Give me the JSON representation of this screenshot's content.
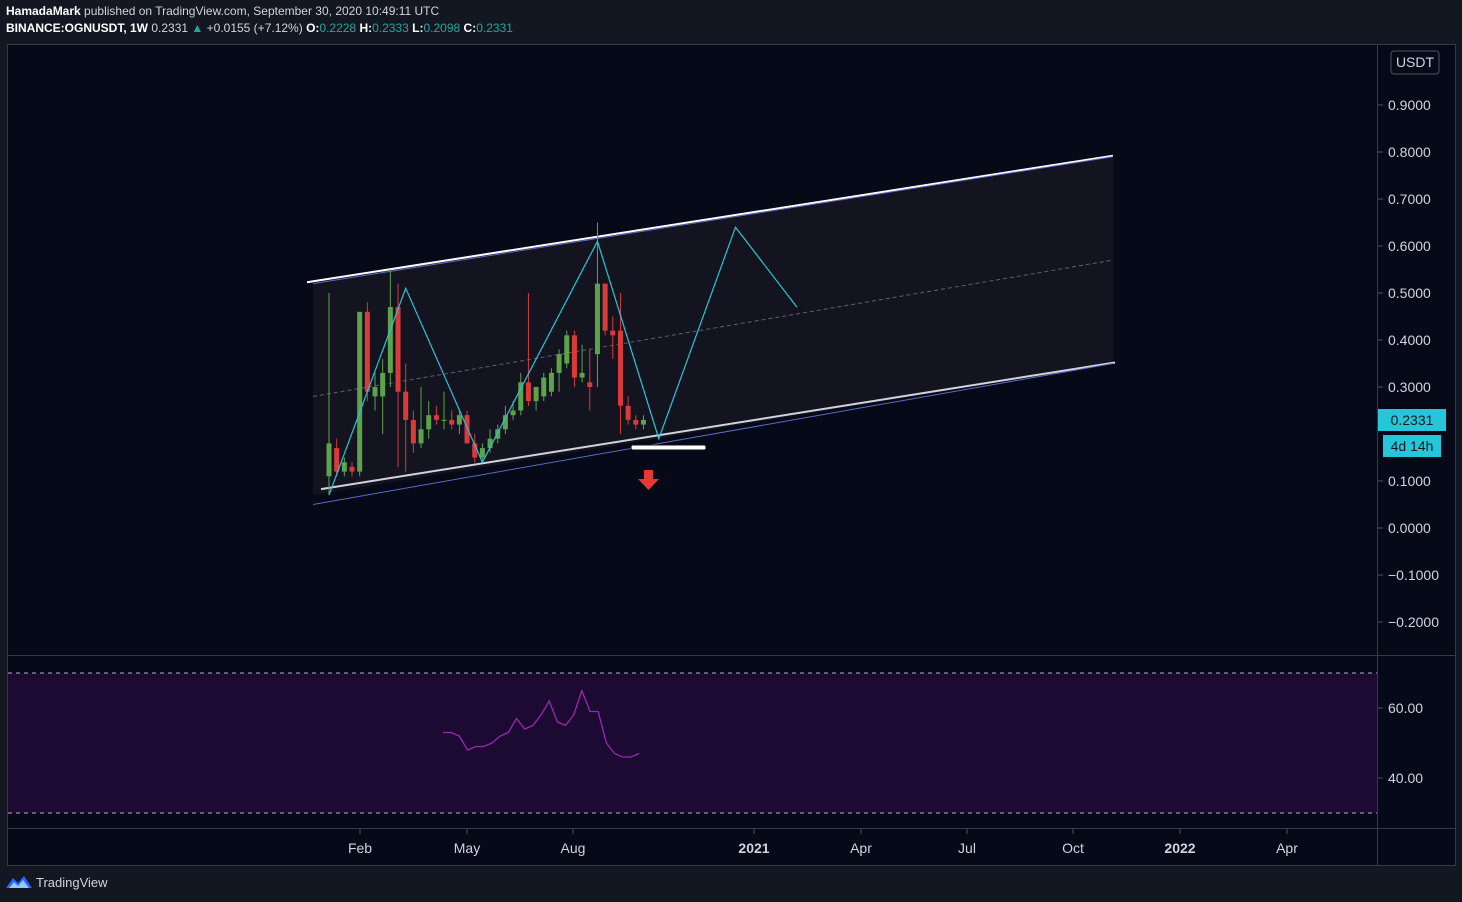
{
  "header": {
    "author": "HamadaMark",
    "published_text": "published on TradingView.com, September 30, 2020 10:49:11 UTC",
    "symbol": "BINANCE:OGNUSDT, 1W",
    "last": "0.2331",
    "change": "+0.0155 (+7.12%)",
    "open_label": "O:",
    "open": "0.2228",
    "high_label": "H:",
    "high": "0.2333",
    "low_label": "L:",
    "low": "0.2098",
    "close_label": "C:",
    "close": "0.2331"
  },
  "footer": {
    "brand": "TradingView"
  },
  "colors": {
    "background": "#131722",
    "pane": "#050918",
    "up": "#5ca34a",
    "down": "#d93a3a",
    "wave": "#26c6da",
    "rsi_line": "#9c27b0",
    "rsi_band": "#1c0a33",
    "price_badge": "#26c6da",
    "arrow": "#e53935"
  },
  "chart_data": [
    {
      "type": "candlestick",
      "currency_label": "USDT",
      "ylim": [
        -0.25,
        0.95
      ],
      "y_ticks": [
        "0.9000",
        "0.8000",
        "0.7000",
        "0.6000",
        "0.5000",
        "0.4000",
        "0.3000",
        "0.1000",
        "0.0000",
        "−0.1000",
        "−0.2000"
      ],
      "last_price_badge": "0.2331",
      "countdown_badge": "4d 14h",
      "x_ticks": [
        "Feb",
        "May",
        "Aug",
        "2021",
        "Apr",
        "Jul",
        "Oct",
        "2022",
        "Apr"
      ],
      "x_tick_bold": [
        false,
        false,
        false,
        true,
        false,
        false,
        false,
        true,
        false
      ],
      "candles": [
        {
          "o": 0.11,
          "h": 0.5,
          "l": 0.07,
          "c": 0.18
        },
        {
          "o": 0.17,
          "h": 0.19,
          "l": 0.11,
          "c": 0.12
        },
        {
          "o": 0.12,
          "h": 0.15,
          "l": 0.11,
          "c": 0.14
        },
        {
          "o": 0.13,
          "h": 0.14,
          "l": 0.11,
          "c": 0.12
        },
        {
          "o": 0.12,
          "h": 0.4,
          "l": 0.11,
          "c": 0.46
        },
        {
          "o": 0.46,
          "h": 0.48,
          "l": 0.27,
          "c": 0.29
        },
        {
          "o": 0.28,
          "h": 0.33,
          "l": 0.25,
          "c": 0.3
        },
        {
          "o": 0.28,
          "h": 0.36,
          "l": 0.2,
          "c": 0.33
        },
        {
          "o": 0.33,
          "h": 0.55,
          "l": 0.3,
          "c": 0.47
        },
        {
          "o": 0.47,
          "h": 0.52,
          "l": 0.13,
          "c": 0.29
        },
        {
          "o": 0.29,
          "h": 0.35,
          "l": 0.12,
          "c": 0.23
        },
        {
          "o": 0.23,
          "h": 0.25,
          "l": 0.16,
          "c": 0.18
        },
        {
          "o": 0.18,
          "h": 0.3,
          "l": 0.17,
          "c": 0.21
        },
        {
          "o": 0.21,
          "h": 0.27,
          "l": 0.19,
          "c": 0.24
        },
        {
          "o": 0.24,
          "h": 0.26,
          "l": 0.22,
          "c": 0.23
        },
        {
          "o": 0.23,
          "h": 0.29,
          "l": 0.21,
          "c": 0.23
        },
        {
          "o": 0.23,
          "h": 0.25,
          "l": 0.21,
          "c": 0.22
        },
        {
          "o": 0.22,
          "h": 0.25,
          "l": 0.2,
          "c": 0.24
        },
        {
          "o": 0.24,
          "h": 0.25,
          "l": 0.18,
          "c": 0.18
        },
        {
          "o": 0.18,
          "h": 0.2,
          "l": 0.14,
          "c": 0.15
        },
        {
          "o": 0.15,
          "h": 0.18,
          "l": 0.14,
          "c": 0.17
        },
        {
          "o": 0.17,
          "h": 0.21,
          "l": 0.16,
          "c": 0.19
        },
        {
          "o": 0.19,
          "h": 0.22,
          "l": 0.18,
          "c": 0.21
        },
        {
          "o": 0.21,
          "h": 0.26,
          "l": 0.2,
          "c": 0.24
        },
        {
          "o": 0.24,
          "h": 0.27,
          "l": 0.23,
          "c": 0.25
        },
        {
          "o": 0.25,
          "h": 0.33,
          "l": 0.24,
          "c": 0.31
        },
        {
          "o": 0.31,
          "h": 0.5,
          "l": 0.26,
          "c": 0.27
        },
        {
          "o": 0.27,
          "h": 0.3,
          "l": 0.25,
          "c": 0.3
        },
        {
          "o": 0.28,
          "h": 0.33,
          "l": 0.27,
          "c": 0.32
        },
        {
          "o": 0.29,
          "h": 0.34,
          "l": 0.28,
          "c": 0.33
        },
        {
          "o": 0.33,
          "h": 0.38,
          "l": 0.29,
          "c": 0.37
        },
        {
          "o": 0.35,
          "h": 0.42,
          "l": 0.34,
          "c": 0.41
        },
        {
          "o": 0.41,
          "h": 0.42,
          "l": 0.3,
          "c": 0.32
        },
        {
          "o": 0.32,
          "h": 0.39,
          "l": 0.31,
          "c": 0.33
        },
        {
          "o": 0.31,
          "h": 0.38,
          "l": 0.25,
          "c": 0.3
        },
        {
          "o": 0.37,
          "h": 0.65,
          "l": 0.3,
          "c": 0.52
        },
        {
          "o": 0.52,
          "h": 0.52,
          "l": 0.41,
          "c": 0.42
        },
        {
          "o": 0.42,
          "h": 0.45,
          "l": 0.36,
          "c": 0.41
        },
        {
          "o": 0.42,
          "h": 0.5,
          "l": 0.2,
          "c": 0.26
        },
        {
          "o": 0.26,
          "h": 0.28,
          "l": 0.22,
          "c": 0.23
        },
        {
          "o": 0.23,
          "h": 0.24,
          "l": 0.21,
          "c": 0.22
        },
        {
          "o": 0.22,
          "h": 0.24,
          "l": 0.21,
          "c": 0.23
        }
      ],
      "channel": {
        "upper": [
          [
            0.0,
            0.52
          ],
          [
            1.0,
            0.79
          ]
        ],
        "lower": [
          [
            0.0,
            0.07
          ],
          [
            1.0,
            0.35
          ]
        ],
        "mid": [
          [
            0.0,
            0.28
          ],
          [
            1.0,
            0.57
          ]
        ]
      },
      "wave_path": [
        [
          0,
          0.07
        ],
        [
          10,
          0.51
        ],
        [
          20,
          0.14
        ],
        [
          35,
          0.61
        ],
        [
          43,
          0.19
        ],
        [
          53,
          0.64
        ],
        [
          61,
          0.47
        ]
      ],
      "support_level": 0.185
    },
    {
      "type": "line",
      "indicator": "RSI",
      "ylim": [
        30,
        72
      ],
      "y_ticks": [
        "60.00",
        "40.00"
      ],
      "band": [
        30,
        70
      ],
      "values": [
        53,
        53,
        52,
        48,
        49,
        49,
        50,
        52,
        53,
        57,
        54,
        55,
        58,
        62,
        56,
        55,
        58,
        65,
        59,
        59,
        50,
        47,
        46,
        46,
        47
      ]
    }
  ]
}
